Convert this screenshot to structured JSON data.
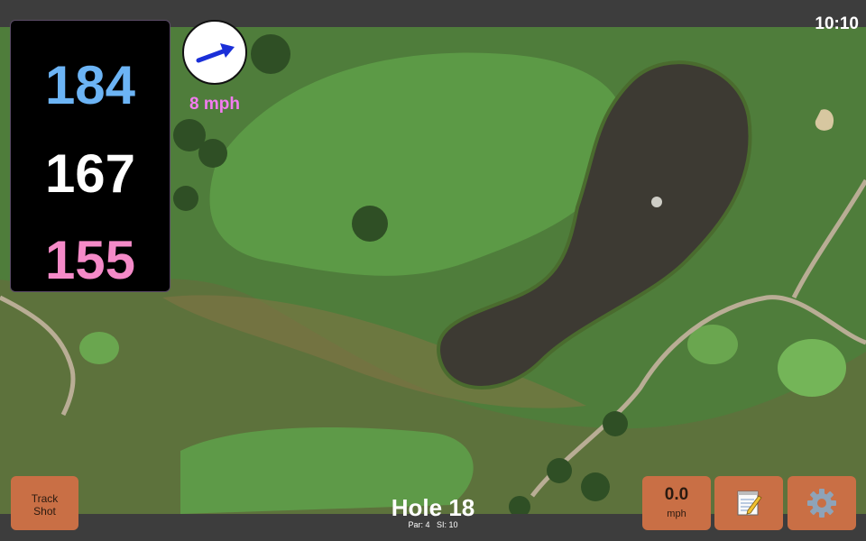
{
  "status": {
    "time": "10:10"
  },
  "distances": {
    "back": {
      "value": "184",
      "color": "#6cb4f5"
    },
    "middle": {
      "value": "167",
      "color": "#ffffff"
    },
    "front": {
      "value": "155",
      "color": "#f58ac8"
    }
  },
  "wind": {
    "speed": "8 mph",
    "arrow_icon": "wind-arrow-icon",
    "text_color": "#f37cf0"
  },
  "buttons": {
    "track_shot": {
      "line1": "Track",
      "line2": "Shot"
    },
    "speed": {
      "value": "0.0",
      "unit": "mph"
    },
    "notes_icon": "notepad-icon",
    "settings_icon": "gear-icon",
    "button_color": "#c96f45"
  },
  "hole": {
    "title": "Hole 18",
    "par_label": "Par: 4",
    "si_label": "SI: 10"
  },
  "map": {
    "fairway_color": "#5c9a46",
    "rough_color": "#4f7d3b",
    "water_color": "#3d3a33",
    "green_color": "#74b558"
  }
}
